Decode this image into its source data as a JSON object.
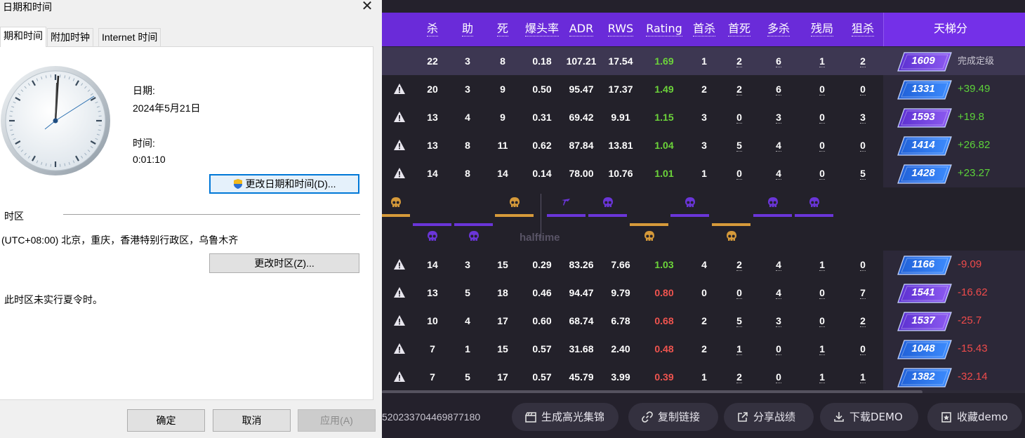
{
  "dialog": {
    "title": "日期和时间",
    "tabs": [
      "期和时间",
      "附加时钟",
      "Internet 时间"
    ],
    "date_label": "日期:",
    "date_value": "2024年5月21日",
    "time_label": "时间:",
    "time_value": "0:01:10",
    "change_datetime_button": "更改日期和时间(D)...",
    "timezone_section": "时区",
    "timezone_value": "(UTC+08:00) 北京，重庆，香港特别行政区，乌鲁木齐",
    "change_timezone_button": "更改时区(Z)...",
    "dst_note": "此时区未实行夏令时。",
    "ok_button": "确定",
    "cancel_button": "取消",
    "apply_button": "应用(A)"
  },
  "stats": {
    "columns": [
      "杀",
      "助",
      "死",
      "爆头率",
      "ADR",
      "RWS",
      "Rating",
      "首杀",
      "首死",
      "多杀",
      "残局",
      "狙杀"
    ],
    "ladder_header": "天梯分",
    "team1": [
      {
        "k": "22",
        "a": "3",
        "d": "8",
        "hs": "0.18",
        "adr": "107.21",
        "rws": "17.54",
        "rating": "1.69",
        "fk": "1",
        "fd": "2",
        "mk": "6",
        "cl": "1",
        "sn": "2",
        "elo": "1609",
        "delta": "完成定级",
        "warn": false,
        "me": true
      },
      {
        "k": "20",
        "a": "3",
        "d": "9",
        "hs": "0.50",
        "adr": "95.47",
        "rws": "17.37",
        "rating": "1.49",
        "fk": "2",
        "fd": "2",
        "mk": "6",
        "cl": "0",
        "sn": "0",
        "elo": "1331",
        "delta": "+39.49",
        "warn": true
      },
      {
        "k": "13",
        "a": "4",
        "d": "9",
        "hs": "0.31",
        "adr": "69.42",
        "rws": "9.91",
        "rating": "1.15",
        "fk": "3",
        "fd": "0",
        "mk": "3",
        "cl": "0",
        "sn": "3",
        "elo": "1593",
        "delta": "+19.8",
        "warn": true
      },
      {
        "k": "13",
        "a": "8",
        "d": "11",
        "hs": "0.62",
        "adr": "87.84",
        "rws": "13.81",
        "rating": "1.04",
        "fk": "3",
        "fd": "5",
        "mk": "4",
        "cl": "0",
        "sn": "0",
        "elo": "1414",
        "delta": "+26.82",
        "warn": true
      },
      {
        "k": "14",
        "a": "8",
        "d": "14",
        "hs": "0.14",
        "adr": "78.00",
        "rws": "10.76",
        "rating": "1.01",
        "fk": "1",
        "fd": "0",
        "mk": "4",
        "cl": "0",
        "sn": "5",
        "elo": "1428",
        "delta": "+23.27",
        "warn": true
      }
    ],
    "team2": [
      {
        "k": "14",
        "a": "3",
        "d": "15",
        "hs": "0.29",
        "adr": "83.26",
        "rws": "7.66",
        "rating": "1.03",
        "fk": "4",
        "fd": "2",
        "mk": "4",
        "cl": "1",
        "sn": "0",
        "elo": "1166",
        "delta": "-9.09",
        "warn": true
      },
      {
        "k": "13",
        "a": "5",
        "d": "18",
        "hs": "0.46",
        "adr": "94.47",
        "rws": "9.79",
        "rating": "0.80",
        "fk": "0",
        "fd": "0",
        "mk": "4",
        "cl": "0",
        "sn": "7",
        "elo": "1541",
        "delta": "-16.62",
        "warn": true
      },
      {
        "k": "10",
        "a": "4",
        "d": "17",
        "hs": "0.60",
        "adr": "68.74",
        "rws": "6.78",
        "rating": "0.68",
        "fk": "2",
        "fd": "5",
        "mk": "3",
        "cl": "0",
        "sn": "2",
        "elo": "1537",
        "delta": "-25.7",
        "warn": true
      },
      {
        "k": "7",
        "a": "1",
        "d": "15",
        "hs": "0.57",
        "adr": "31.68",
        "rws": "2.40",
        "rating": "0.48",
        "fk": "2",
        "fd": "1",
        "mk": "0",
        "cl": "1",
        "sn": "0",
        "elo": "1048",
        "delta": "-15.43",
        "warn": true
      },
      {
        "k": "7",
        "a": "5",
        "d": "17",
        "hs": "0.57",
        "adr": "45.79",
        "rws": "3.99",
        "rating": "0.39",
        "fk": "1",
        "fd": "2",
        "mk": "0",
        "cl": "1",
        "sn": "1",
        "elo": "1382",
        "delta": "-32.14",
        "warn": true
      }
    ],
    "halftime_label": "halftime",
    "match_id": "520233704469877180",
    "actions": [
      "生成高光集锦",
      "复制链接",
      "分享战绩",
      "下载DEMO",
      "收藏demo"
    ],
    "colors": {
      "header": "#6a2bd9",
      "good": "#6cd43a",
      "bad": "#f0544f",
      "gold": "#d69a3a",
      "purple": "#6a35d8"
    }
  }
}
